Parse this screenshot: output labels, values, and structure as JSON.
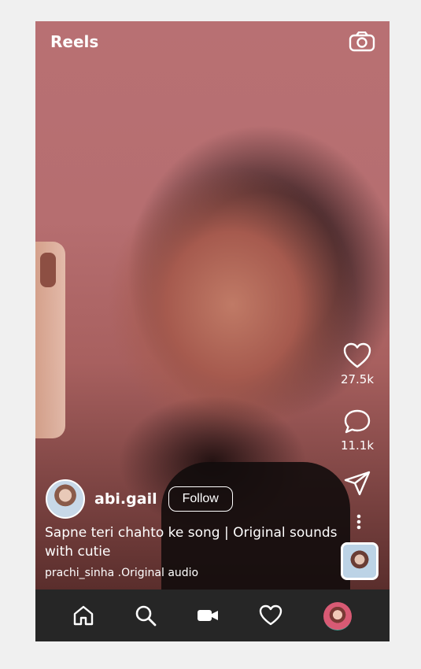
{
  "header": {
    "title": "Reels",
    "camera_icon": "camera-icon"
  },
  "actions": {
    "likes": "27.5k",
    "comments": "11.1k",
    "like_icon": "heart-icon",
    "comment_icon": "comment-icon",
    "share_icon": "send-icon",
    "more_icon": "more-vertical-icon"
  },
  "post": {
    "username": "abi.gail",
    "follow_label": "Follow",
    "caption": "Sapne teri chahto ke song | Original sounds with cutie",
    "audio": "prachi_sinha .Original audio"
  },
  "bottom_nav": {
    "items": [
      "home-icon",
      "search-icon",
      "reels-video-icon",
      "heart-icon",
      "profile-avatar"
    ]
  },
  "colors": {
    "nav_bg": "#262626",
    "page_bg": "#f0f0f0",
    "text": "#ffffff"
  }
}
